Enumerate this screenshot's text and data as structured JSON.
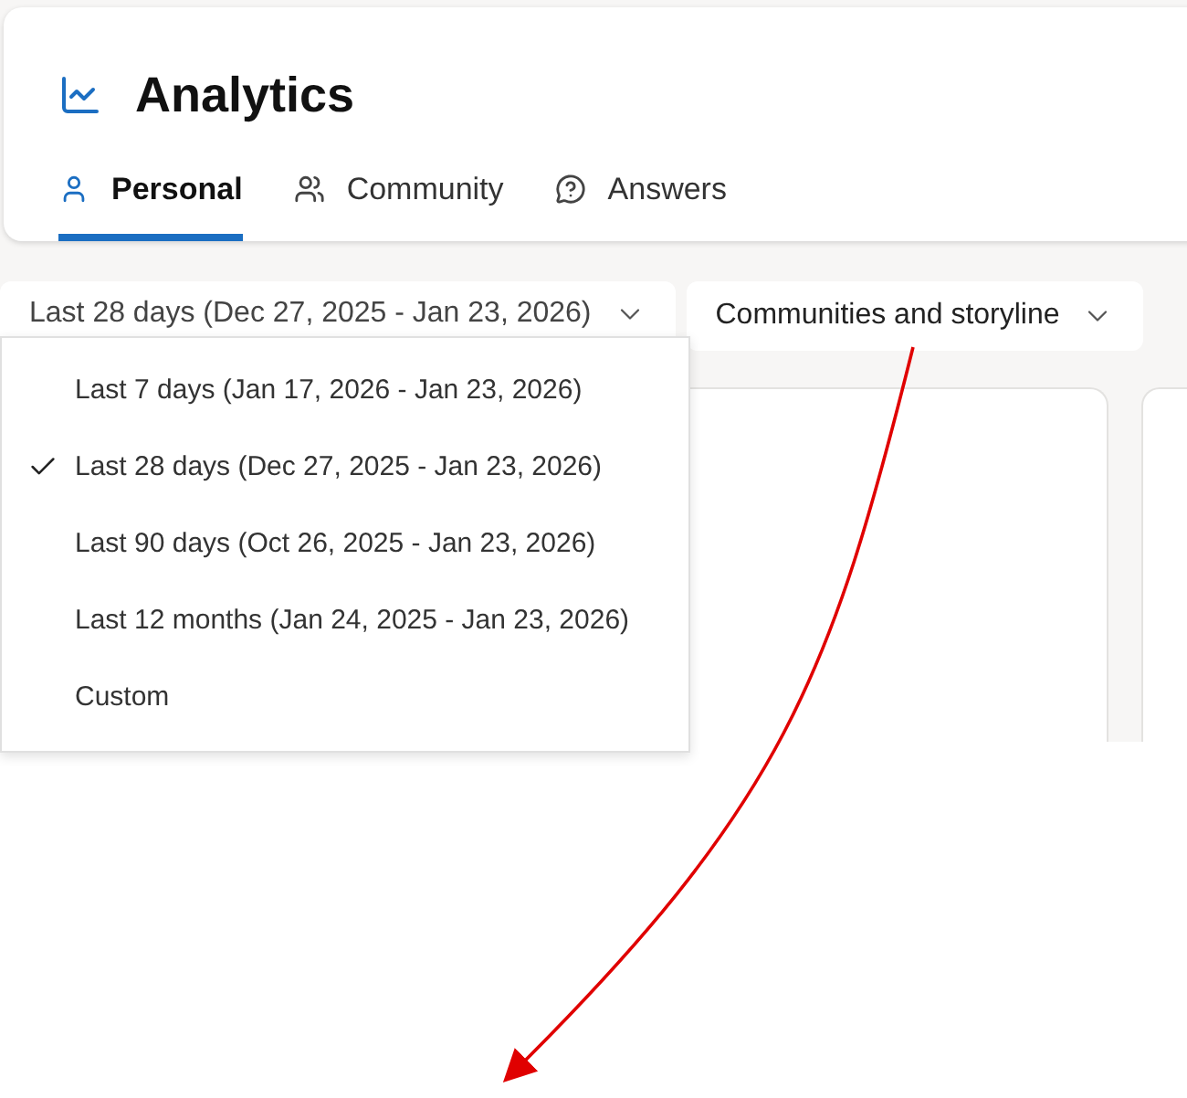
{
  "header": {
    "title": "Analytics"
  },
  "tabs": [
    {
      "label": "Personal",
      "selected": true,
      "kind": "person"
    },
    {
      "label": "Community",
      "selected": false,
      "kind": "group"
    },
    {
      "label": "Answers",
      "selected": false,
      "kind": "question"
    }
  ],
  "filters": [
    {
      "label": "Last 28 days (Dec 27, 2025 - Jan 23, 2026)",
      "expanded": true
    },
    {
      "label": "Communities and storyline",
      "expanded": false
    }
  ],
  "menu": [
    {
      "label": "Last 7 days (Jan 17, 2026 - Jan 23, 2026)",
      "selected": false
    },
    {
      "label": "Last 28 days (Dec 27, 2025 - Jan 23, 2026)",
      "selected": true
    },
    {
      "label": "Last 90 days (Oct 26, 2025 - Jan 23, 2026)",
      "selected": false
    },
    {
      "label": "Last 12 months (Jan 24, 2025 - Jan 23, 2026)",
      "selected": false
    },
    {
      "label": "Custom",
      "selected": false
    }
  ]
}
